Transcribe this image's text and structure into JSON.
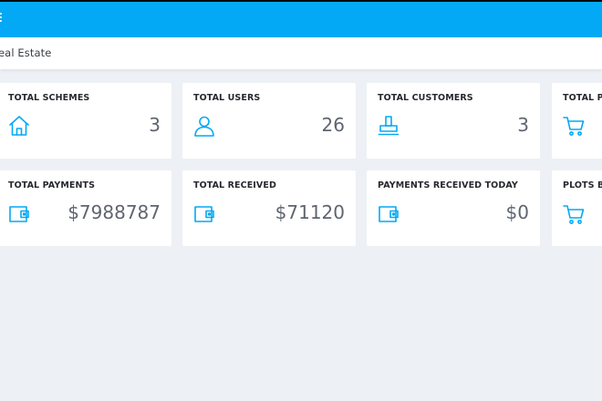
{
  "header": {
    "accent_color": "#03a9f4",
    "menu_icon": "hamburger-menu-icon"
  },
  "breadcrumb": {
    "text": "eal Estate"
  },
  "cards": [
    {
      "title": "TOTAL SCHEMES",
      "value": "3",
      "icon": "home-icon"
    },
    {
      "title": "TOTAL USERS",
      "value": "26",
      "icon": "user-icon"
    },
    {
      "title": "TOTAL CUSTOMERS",
      "value": "3",
      "icon": "stamp-icon"
    },
    {
      "title": "TOTAL PL",
      "value": "",
      "icon": "cart-icon"
    },
    {
      "title": "TOTAL PAYMENTS",
      "value": "$7988787",
      "icon": "wallet-icon"
    },
    {
      "title": "TOTAL RECEIVED",
      "value": "$71120",
      "icon": "wallet-icon"
    },
    {
      "title": "PAYMENTS RECEIVED TODAY",
      "value": "$0",
      "icon": "wallet-icon"
    },
    {
      "title": "PLOTS BO",
      "value": "",
      "icon": "cart-icon"
    }
  ]
}
